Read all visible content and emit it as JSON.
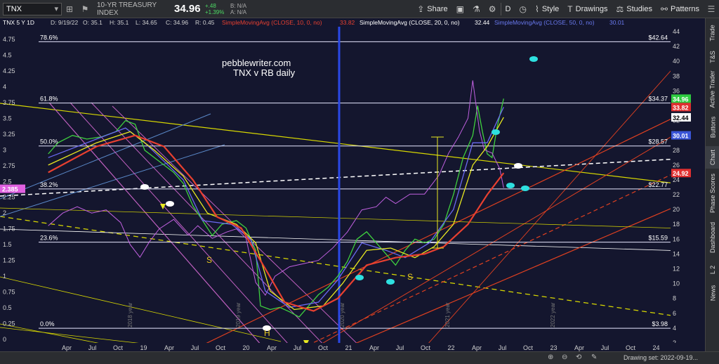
{
  "toolbar": {
    "symbol": "TNX",
    "index_name": "10-YR TREASURY INDEX",
    "last_price": "34.96",
    "change": "+.48",
    "change_pct": "+1.39%",
    "bid": "B: N/A",
    "ask": "A: N/A",
    "share_label": "Share",
    "period_label": "D",
    "style_label": "Style",
    "drawings_label": "Drawings",
    "studies_label": "Studies",
    "patterns_label": "Patterns"
  },
  "chart_header": {
    "ohlc": "TNX 5 Y 1D",
    "date": "D: 9/19/22",
    "open": "O: 35.1",
    "high": "H: 35.1",
    "low": "L: 34.65",
    "close": "C: 34.96",
    "range": "R: 0.45",
    "sma10": "SimpleMovingAvg (CLOSE, 10, 0, no)",
    "sma10_value": "33.82",
    "sma20": "SimpleMovingAvg (CLOSE, 20, 0, no)",
    "sma20_value": "32.44",
    "sma50": "SimpleMovingAvg (CLOSE, 50, 0, no)",
    "sma50_value": "30.01"
  },
  "annotations": {
    "site": "pebblewriter.com",
    "subtitle": "TNX v RB daily",
    "s1": "S",
    "s2": "S",
    "h": "H"
  },
  "fib_levels": [
    {
      "label": "78.6%",
      "value_label": "$42.64",
      "y": 42.64
    },
    {
      "label": "61.8%",
      "value_label": "$34.37",
      "y": 34.37
    },
    {
      "label": "50.0%",
      "value_label": "$28.57",
      "y": 28.57
    },
    {
      "label": "38.2%",
      "value_label": "$22.77",
      "y": 22.77
    },
    {
      "label": "23.6%",
      "value_label": "$15.59",
      "y": 15.59
    },
    {
      "label": "0.0%",
      "value_label": "$3.98",
      "y": 3.98
    }
  ],
  "right_axis_badges": [
    {
      "text": "34.96",
      "color": "#2ecc40",
      "y": 34.96
    },
    {
      "text": "33.82",
      "color": "#e03030",
      "y": 33.82
    },
    {
      "text": "32.44",
      "color": "#ffffff",
      "y": 32.44
    },
    {
      "text": "30.01",
      "color": "#3a55d8",
      "y": 30.01
    },
    {
      "text": "24.92",
      "color": "#e03030",
      "y": 24.92
    }
  ],
  "left_badge": {
    "text": "2.385",
    "y": 2.385
  },
  "year_markers": [
    "2018 year",
    "2019 year",
    "2020 year",
    "2021 year",
    "2022 year"
  ],
  "sidebar_tabs": [
    "Trade",
    "T&S",
    "Active Trader",
    "Buttons",
    "Chart",
    "Phase Scores",
    "Dashboard",
    "L 2",
    "News"
  ],
  "drawing_set": "Drawing set: 2022-09-19...",
  "chart_data": {
    "type": "line",
    "title": "",
    "left_axis": {
      "min": 0,
      "max": 4.75,
      "ticks": [
        "0",
        "0.25",
        "0.5",
        "0.75",
        "1",
        "1.25",
        "1.5",
        "1.75",
        "2",
        "2.25",
        "2.5",
        "2.75",
        "3",
        "3.25",
        "3.5",
        "3.75",
        "4",
        "4.25",
        "4.5",
        "4.75"
      ]
    },
    "right_axis": {
      "min": 2,
      "max": 44,
      "ticks": [
        "2",
        "4",
        "6",
        "8",
        "10",
        "12",
        "14",
        "16",
        "18",
        "20",
        "22",
        "24",
        "26",
        "28",
        "30",
        "32",
        "34",
        "36",
        "38",
        "40",
        "42",
        "44"
      ]
    },
    "x_ticks": [
      "Apr",
      "Jul",
      "Oct",
      "19",
      "Apr",
      "Jul",
      "Oct",
      "20",
      "Apr",
      "Jul",
      "Oct",
      "21",
      "Apr",
      "Jul",
      "Oct",
      "22",
      "Apr",
      "Jul",
      "Oct",
      "23",
      "Apr",
      "Jul",
      "Oct",
      "24"
    ],
    "grid": false,
    "series": [
      {
        "name": "TNX",
        "color": "#3fd03f",
        "points": [
          [
            2018.0,
            27.5
          ],
          [
            2018.1,
            29
          ],
          [
            2018.25,
            30
          ],
          [
            2018.4,
            29.5
          ],
          [
            2018.55,
            29.8
          ],
          [
            2018.7,
            30.5
          ],
          [
            2018.8,
            32
          ],
          [
            2018.9,
            31.5
          ],
          [
            2019.0,
            28
          ],
          [
            2019.15,
            26.5
          ],
          [
            2019.3,
            25
          ],
          [
            2019.4,
            23.5
          ],
          [
            2019.5,
            20.5
          ],
          [
            2019.6,
            18.5
          ],
          [
            2019.7,
            16.5
          ],
          [
            2019.8,
            18
          ],
          [
            2019.95,
            18.5
          ],
          [
            2020.05,
            17.5
          ],
          [
            2020.15,
            14.5
          ],
          [
            2020.2,
            7
          ],
          [
            2020.3,
            6.5
          ],
          [
            2020.4,
            6.8
          ],
          [
            2020.5,
            6.2
          ],
          [
            2020.6,
            5.5
          ],
          [
            2020.7,
            7
          ],
          [
            2020.8,
            8.5
          ],
          [
            2020.9,
            9.5
          ],
          [
            2021.0,
            11
          ],
          [
            2021.1,
            13
          ],
          [
            2021.2,
            16
          ],
          [
            2021.3,
            17
          ],
          [
            2021.4,
            15.5
          ],
          [
            2021.5,
            14
          ],
          [
            2021.6,
            12.5
          ],
          [
            2021.7,
            14.5
          ],
          [
            2021.8,
            16
          ],
          [
            2021.9,
            15.5
          ],
          [
            2022.0,
            16
          ],
          [
            2022.1,
            18
          ],
          [
            2022.2,
            22
          ],
          [
            2022.3,
            27
          ],
          [
            2022.4,
            30
          ],
          [
            2022.45,
            34
          ],
          [
            2022.5,
            30.5
          ],
          [
            2022.55,
            27.5
          ],
          [
            2022.6,
            27
          ],
          [
            2022.65,
            31
          ],
          [
            2022.72,
            34.96
          ]
        ]
      },
      {
        "name": "RB",
        "color": "#c060e0",
        "points": [
          [
            2018.0,
            1.8
          ],
          [
            2018.15,
            2.0
          ],
          [
            2018.3,
            2.1
          ],
          [
            2018.45,
            2.0
          ],
          [
            2018.6,
            2.05
          ],
          [
            2018.75,
            1.85
          ],
          [
            2018.85,
            1.5
          ],
          [
            2018.95,
            1.3
          ],
          [
            2019.05,
            1.55
          ],
          [
            2019.15,
            1.75
          ],
          [
            2019.3,
            1.9
          ],
          [
            2019.45,
            1.65
          ],
          [
            2019.55,
            1.8
          ],
          [
            2019.7,
            1.6
          ],
          [
            2019.85,
            1.7
          ],
          [
            2019.95,
            1.75
          ],
          [
            2020.05,
            1.6
          ],
          [
            2020.15,
            0.9
          ],
          [
            2020.25,
            0.7
          ],
          [
            2020.35,
            1.0
          ],
          [
            2020.5,
            1.15
          ],
          [
            2020.65,
            1.2
          ],
          [
            2020.8,
            1.25
          ],
          [
            2020.95,
            1.45
          ],
          [
            2021.1,
            1.7
          ],
          [
            2021.25,
            2.05
          ],
          [
            2021.4,
            2.1
          ],
          [
            2021.5,
            2.25
          ],
          [
            2021.6,
            2.15
          ],
          [
            2021.75,
            2.3
          ],
          [
            2021.9,
            2.3
          ],
          [
            2022.05,
            2.6
          ],
          [
            2022.15,
            2.95
          ],
          [
            2022.25,
            3.2
          ],
          [
            2022.35,
            3.5
          ],
          [
            2022.4,
            4.1
          ],
          [
            2022.47,
            3.3
          ],
          [
            2022.52,
            3.0
          ],
          [
            2022.6,
            2.95
          ],
          [
            2022.68,
            2.7
          ],
          [
            2022.72,
            2.4
          ]
        ]
      }
    ]
  }
}
